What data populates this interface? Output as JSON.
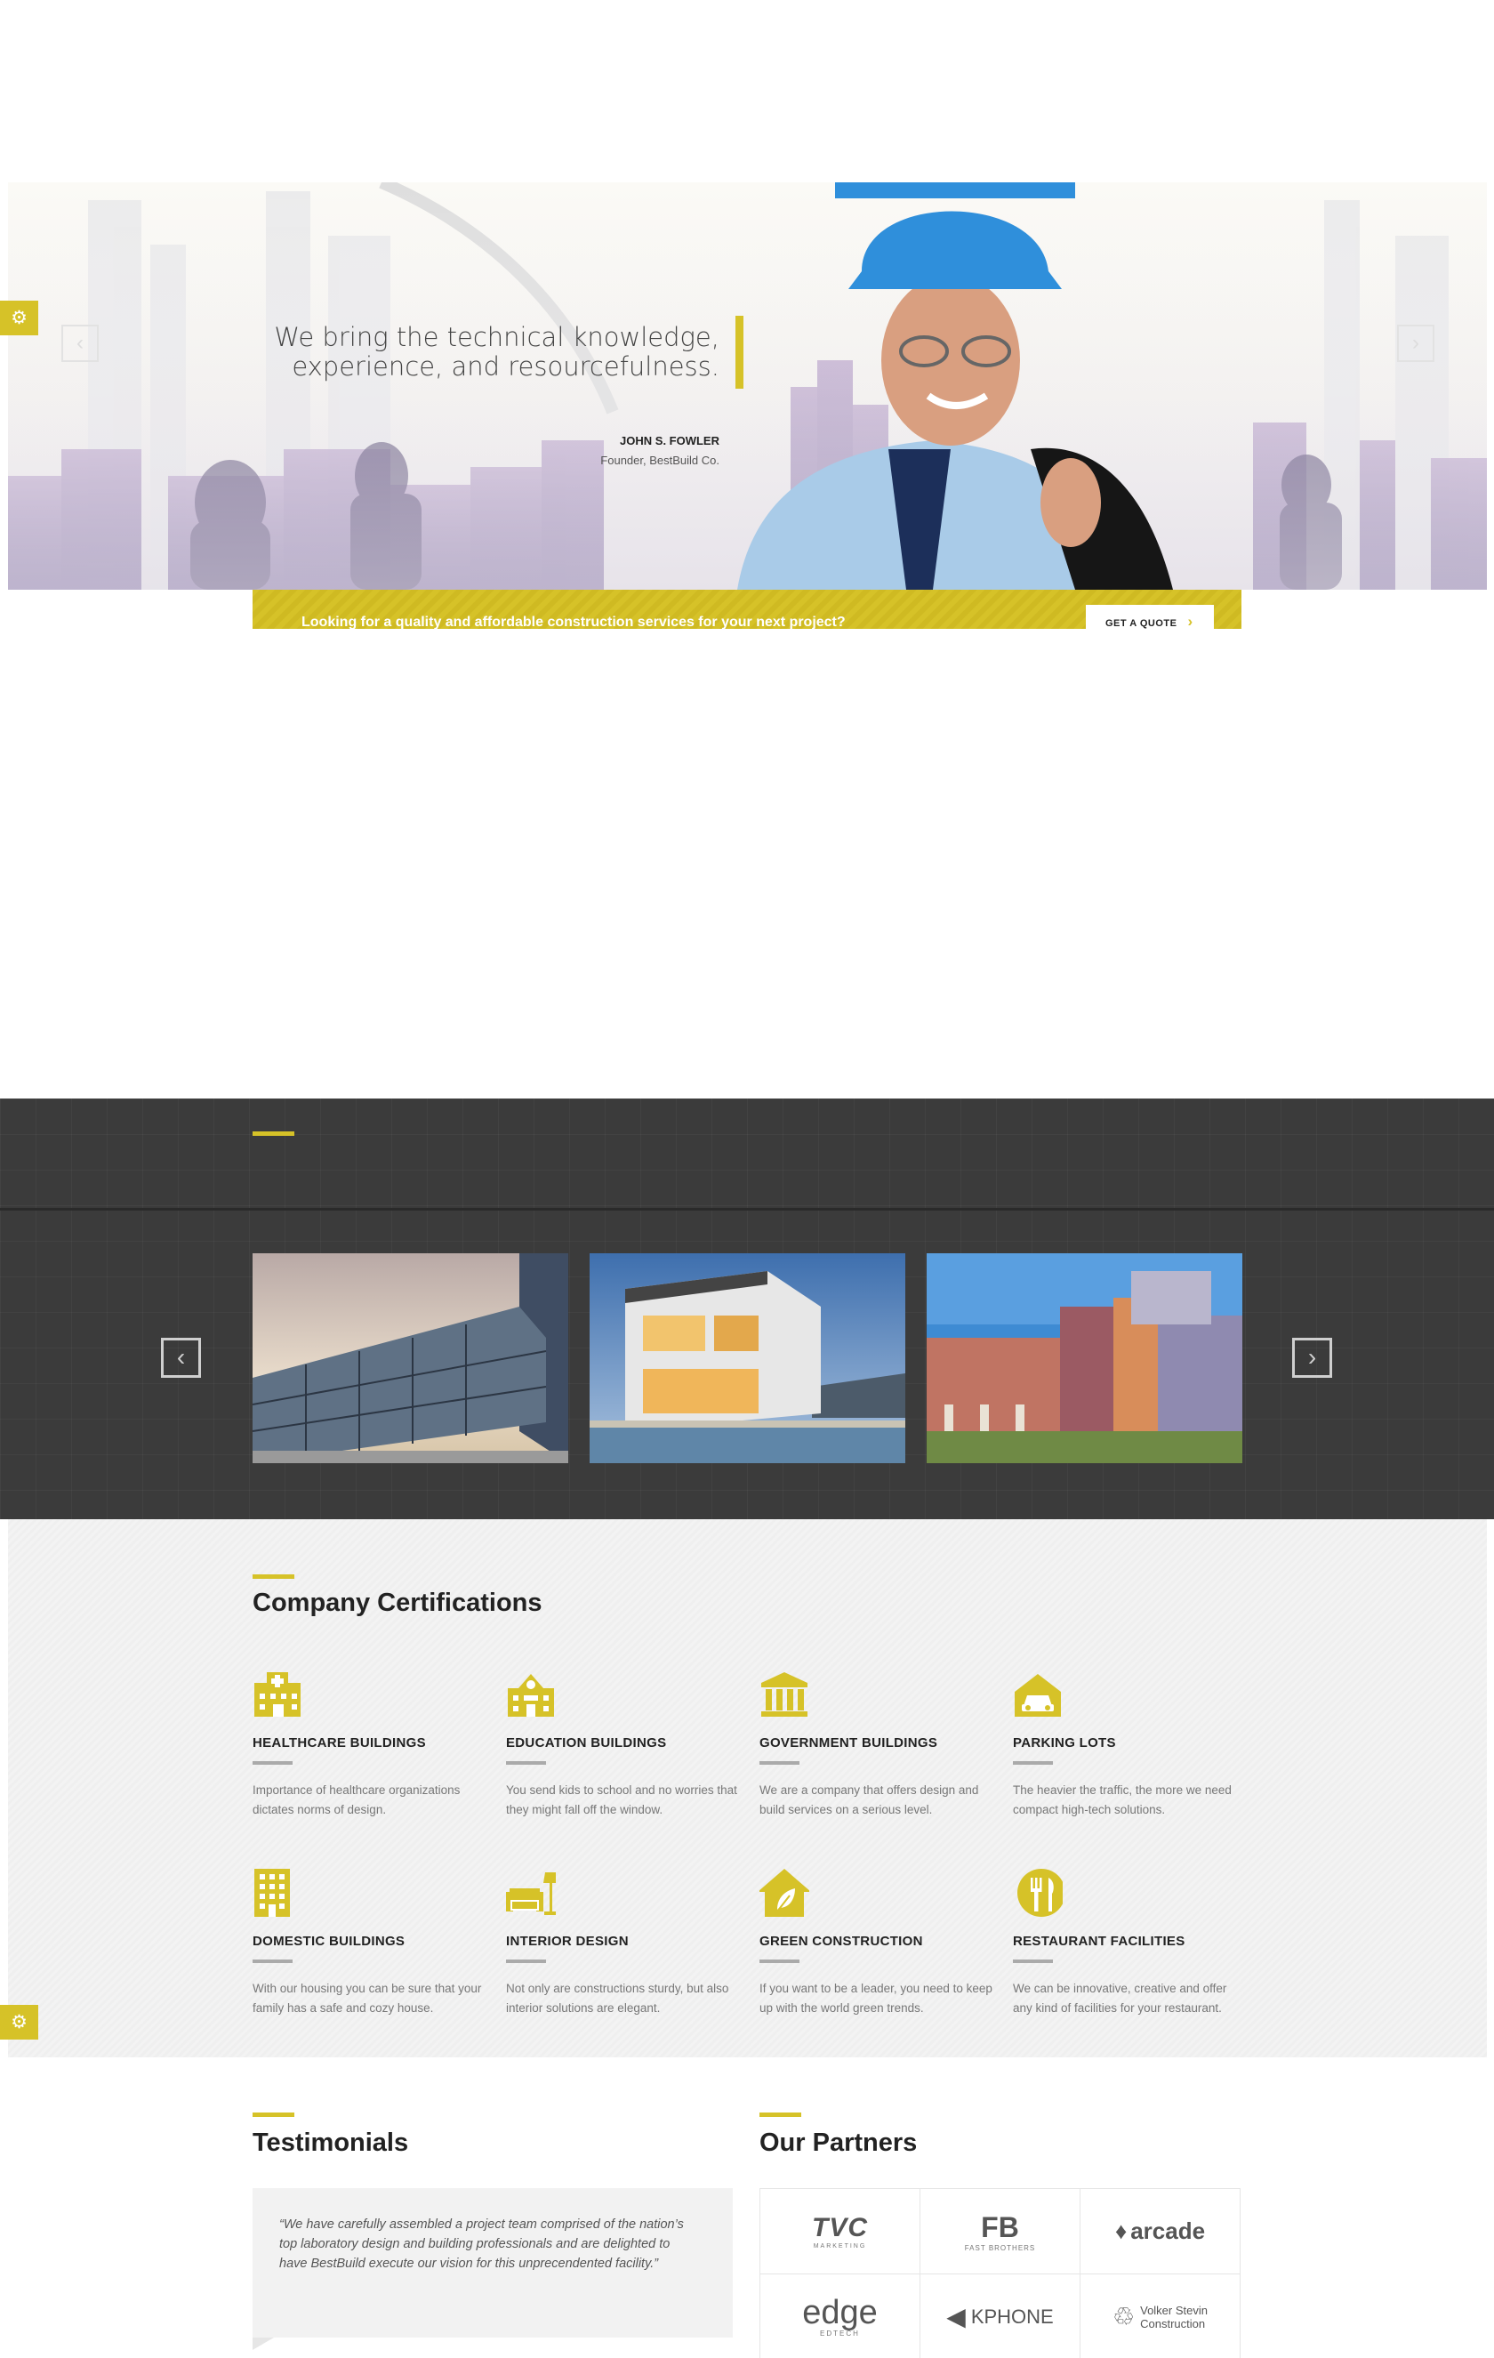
{
  "hero": {
    "quote_line1": "We bring the technical knowledge,",
    "quote_line2": "experience, and resourcefulness.",
    "author_name": "JOHN S. FOWLER",
    "author_role": "Founder, BestBuild Co.",
    "prev_arrow": "‹",
    "next_arrow": "›"
  },
  "settings_icon_glyph": "⚙",
  "cta": {
    "text": "Looking for a quality and affordable construction services for your next project?",
    "button_label": "GET A QUOTE",
    "button_chevron": "›"
  },
  "projects": {
    "prev": "‹",
    "next": "›",
    "items": [
      "glass-building",
      "modern-house",
      "school-building"
    ]
  },
  "certifications": {
    "title": "Company Certifications",
    "items": [
      {
        "icon": "hospital-icon",
        "title": "HEALTHCARE BUILDINGS",
        "desc": "Importance of healthcare organizations dictates norms of design."
      },
      {
        "icon": "school-icon",
        "title": "EDUCATION BUILDINGS",
        "desc": "You send kids to school and no worries that they might fall off the window."
      },
      {
        "icon": "government-icon",
        "title": "GOVERNMENT BUILDINGS",
        "desc": "We are a company that offers design and build services on a serious level."
      },
      {
        "icon": "parking-icon",
        "title": "PARKING LOTS",
        "desc": "The heavier the traffic, the more we need compact high-tech solutions."
      },
      {
        "icon": "apartment-icon",
        "title": "DOMESTIC BUILDINGS",
        "desc": "With our housing you can be sure that your family has a safe and cozy house."
      },
      {
        "icon": "sofa-lamp-icon",
        "title": "INTERIOR DESIGN",
        "desc": "Not only are constructions sturdy,  but also interior solutions are elegant."
      },
      {
        "icon": "eco-house-icon",
        "title": "GREEN CONSTRUCTION",
        "desc": "If you want to be a leader, you need to keep up with the world green trends."
      },
      {
        "icon": "restaurant-icon",
        "title": "RESTAURANT FACILITIES",
        "desc": "We can be innovative, creative and offer any kind of facilities for your restaurant."
      }
    ]
  },
  "testimonials": {
    "title": "Testimonials",
    "quote": "“We have carefully assembled a project team comprised of the nation’s top laboratory design and building professionals and are delighted to have BestBuild execute our vision for this unprecendented facility.”"
  },
  "partners": {
    "title": "Our Partners",
    "logos": {
      "tvc": "TVC",
      "tvc_sub": "MARKETING",
      "fb": "FB",
      "fb_sub": "FAST BROTHERS",
      "arcade": "arcade",
      "edge": "edge",
      "edge_sub": "EDTECH",
      "kphone": "KPHONE",
      "volker_line1": "Volker Stevin",
      "volker_line2": "Construction"
    }
  },
  "colors": {
    "accent": "#d6c228",
    "dark_bg": "#3b3b3b",
    "light_bg": "#f2f2f2"
  }
}
